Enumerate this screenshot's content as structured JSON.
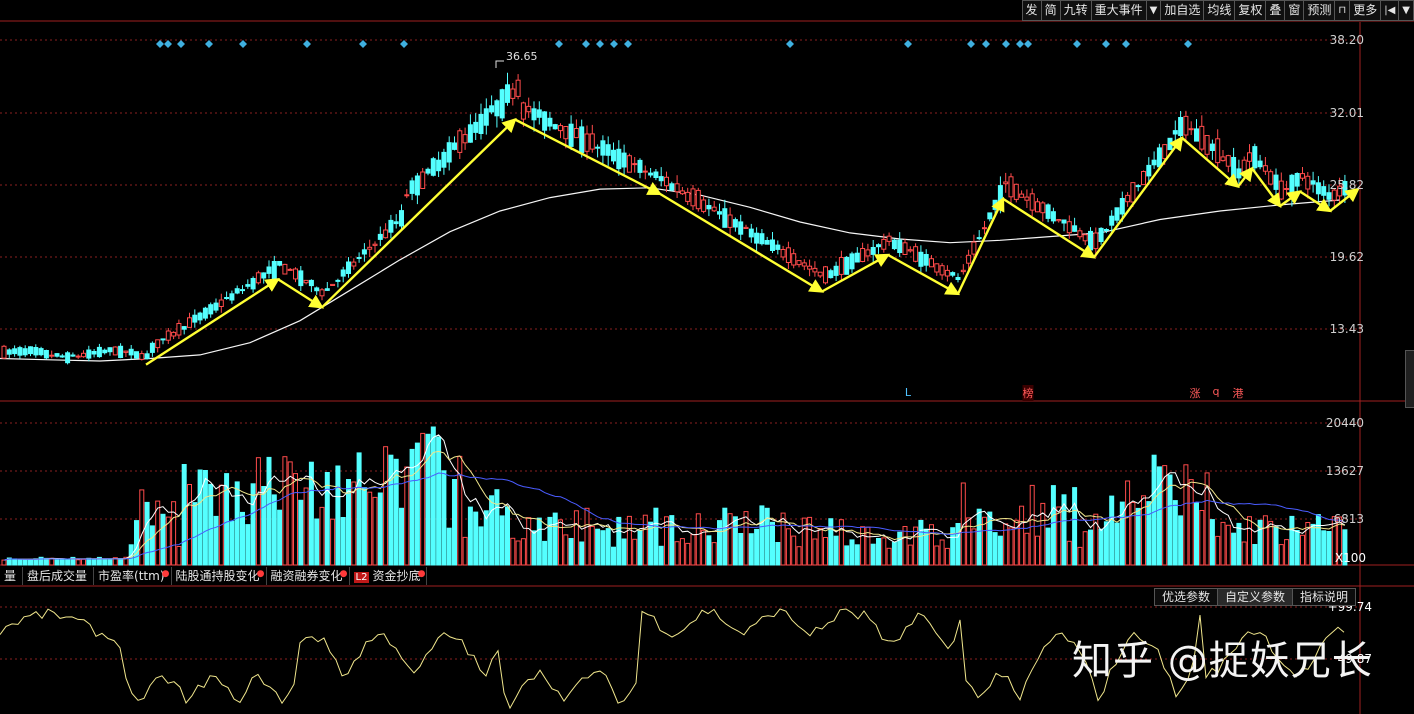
{
  "toolbar": {
    "items": [
      "发",
      "简",
      "九转",
      "重大事件",
      "加自选",
      "均线",
      "复权",
      "叠",
      "窗",
      "预测",
      "更多"
    ]
  },
  "price_axis": {
    "labels": [
      "38.20",
      "32.01",
      "25.82",
      "19.62",
      "13.43"
    ]
  },
  "peak_label": "36.65",
  "volume_axis": {
    "labels": [
      "20440",
      "13627",
      "6813"
    ],
    "unit": "X100"
  },
  "osc_axis": {
    "labels": [
      "+99.74",
      "49.87"
    ]
  },
  "event_markers": {
    "L": "L",
    "bang": "榜",
    "zhang": "涨",
    "q": "q",
    "gang": "港"
  },
  "indicator_tabs": [
    "量",
    "盘后成交量",
    "市盈率(ttm)",
    "陆股通持股变化",
    "融资融券变化",
    "资金抄底"
  ],
  "l2_badge": "L2",
  "param_tabs": [
    "优选参数",
    "自定义参数",
    "指标说明"
  ],
  "watermark": "知乎 @捉妖兄长",
  "colors": {
    "up": "#ff4b4b",
    "down": "#54ffff",
    "ma_long": "#f5f5f5",
    "arrow": "#ffff33",
    "diamond": "#3fb0e0",
    "grid": "#8a1f1f",
    "volume_ma_blue": "#4a5cff",
    "osc_line": "#f0e68c"
  },
  "chart_data": [
    {
      "type": "candlestick",
      "price_range": [
        9.5,
        40.5
      ],
      "ma_long": [
        12.9,
        12.8,
        12.7,
        12.9,
        13.2,
        14.2,
        16.0,
        18.5,
        21.0,
        23.3,
        25.0,
        26.1,
        26.8,
        26.9,
        26.3,
        25.3,
        24.1,
        23.2,
        22.7,
        22.4,
        22.6,
        23.2,
        24.3,
        25.0,
        25.5,
        25.9
      ],
      "ma_long_x": [
        0,
        50,
        100,
        150,
        200,
        250,
        300,
        350,
        400,
        450,
        500,
        550,
        600,
        650,
        700,
        750,
        800,
        850,
        900,
        950,
        1000,
        1100,
        1160,
        1220,
        1280,
        1340
      ],
      "arrows": [
        [
          146,
          12.4,
          278,
          19.4
        ],
        [
          278,
          19.4,
          322,
          17.1
        ],
        [
          322,
          17.1,
          515,
          32.5
        ],
        [
          515,
          32.5,
          660,
          26.4
        ],
        [
          660,
          26.4,
          822,
          18.4
        ],
        [
          822,
          18.4,
          888,
          21.4
        ],
        [
          888,
          21.4,
          958,
          18.2
        ],
        [
          958,
          18.2,
          1003,
          26.0
        ],
        [
          1003,
          26.0,
          1094,
          21.2
        ],
        [
          1094,
          21.2,
          1182,
          31.0
        ],
        [
          1182,
          31.0,
          1238,
          27.0
        ],
        [
          1238,
          27.0,
          1252,
          28.5
        ],
        [
          1252,
          28.5,
          1280,
          25.4
        ],
        [
          1280,
          25.4,
          1300,
          26.6
        ],
        [
          1300,
          26.6,
          1330,
          25.0
        ],
        [
          1330,
          25.0,
          1358,
          26.8
        ]
      ]
    },
    {
      "type": "bar",
      "title": "volume",
      "ylim": [
        0,
        22000
      ]
    },
    {
      "type": "line",
      "title": "oscillator",
      "ylim": [
        0,
        100
      ]
    }
  ]
}
